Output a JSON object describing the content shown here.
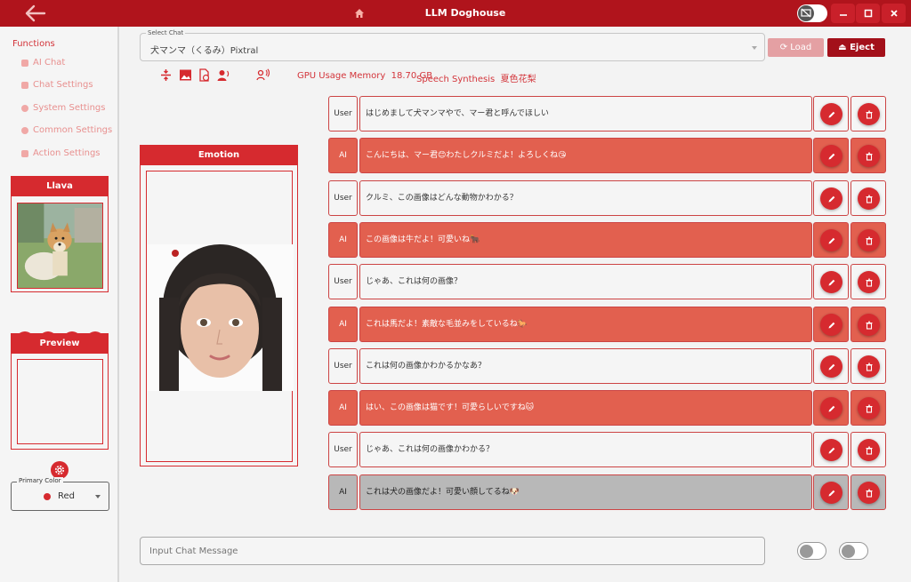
{
  "window": {
    "title": "LLM Doghouse",
    "accent": "#b0141c"
  },
  "sidebar": {
    "functions_title": "Functions",
    "items": [
      {
        "label": "AI Chat",
        "icon": "chat-icon"
      },
      {
        "label": "Chat Settings",
        "icon": "users-icon"
      },
      {
        "label": "System Settings",
        "icon": "gear-icon"
      },
      {
        "label": "Common Settings",
        "icon": "gear-icon"
      },
      {
        "label": "Action Settings",
        "icon": "image-icon"
      }
    ],
    "llava_title": "Llava",
    "preview_title": "Preview",
    "primary_color_label": "Primary Color",
    "primary_color_value": "Red"
  },
  "header": {
    "select_chat_label": "Select Chat",
    "select_chat_value": "犬マンマ（くるみ）Pixtral",
    "load_label": "Load",
    "eject_label": "Eject",
    "gpu_label": "GPU Usage Memory",
    "gpu_value": "18.70 GB",
    "speech_label": "Speech Synthesis",
    "speech_value": "夏色花梨"
  },
  "emotion": {
    "title": "Emotion"
  },
  "messages": [
    {
      "role": "User",
      "text": "はじめまして犬マンマやで、マー君と呼んでほしい",
      "style": "user"
    },
    {
      "role": "AI",
      "text": "こんにちは、マー君😊わたしクルミだよ！よろしくね😘",
      "style": "ai"
    },
    {
      "role": "User",
      "text": "クルミ、この画像はどんな動物かわかる？",
      "style": "user"
    },
    {
      "role": "AI",
      "text": "この画像は牛だよ！可愛いね🐂",
      "style": "ai"
    },
    {
      "role": "User",
      "text": "じゃあ、これは何の画像？",
      "style": "user"
    },
    {
      "role": "AI",
      "text": "これは馬だよ！素敵な毛並みをしているね🐎",
      "style": "ai"
    },
    {
      "role": "User",
      "text": "これは何の画像かわかるかなあ？",
      "style": "user"
    },
    {
      "role": "AI",
      "text": "はい、この画像は猫です！可愛らしいですね🐱",
      "style": "ai"
    },
    {
      "role": "User",
      "text": "じゃあ、これは何の画像かわかる？",
      "style": "user"
    },
    {
      "role": "AI",
      "text": "これは犬の画像だよ！可愛い顔してるね🐶",
      "style": "sel"
    }
  ],
  "input": {
    "placeholder": "Input Chat Message"
  }
}
